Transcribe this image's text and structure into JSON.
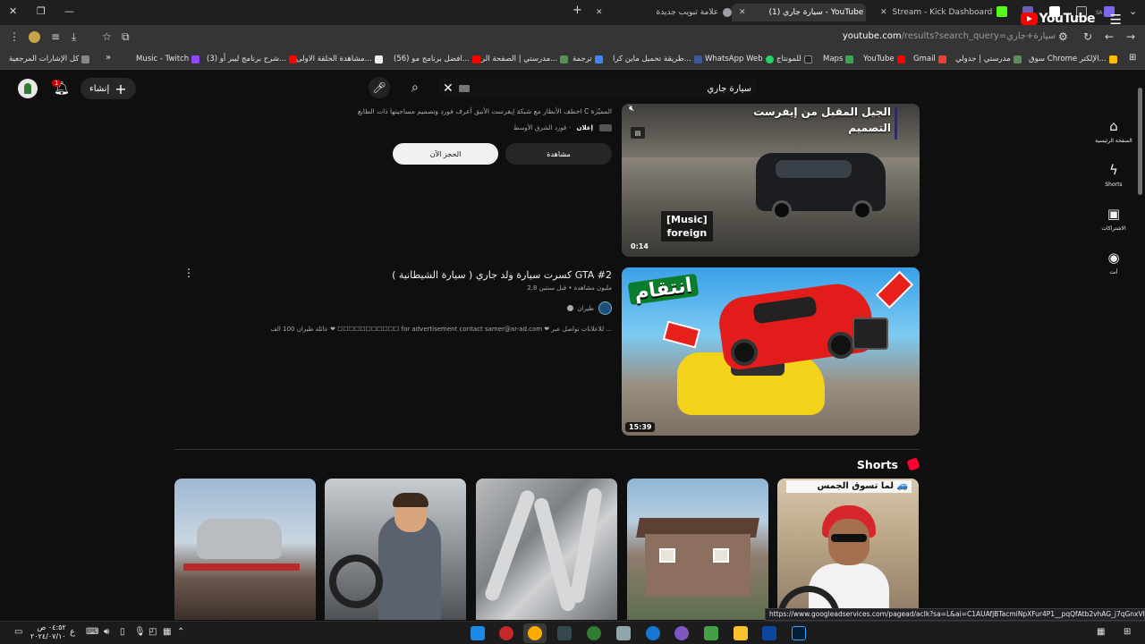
{
  "browser": {
    "tabs": [
      {
        "title": "Stream - Kick Dashboard",
        "fav_color": "#53fc18"
      },
      {
        "title": "(1) سيارة جاري - YouTube",
        "fav_color": "#ff0000",
        "active": true
      },
      {
        "title": "علامة تبويب جديدة",
        "fav_color": "#9aa0a6"
      }
    ],
    "url_host": "youtube.com",
    "url_path": "/results?search_query=سيارة+جاري",
    "bookmarks": [
      "سوق Chrome الإلكتر...",
      "مدرستي | جدولي",
      "Gmail",
      "YouTube",
      "Maps",
      "للمونتاج",
      "WhatsApp Web",
      "طريقة تحميل ماين كرا...",
      "ترجمة",
      "مدرستي | الصفحة الر...",
      "(56) افضل برنامج مو...",
      "مشاهدة الحلقة الاولى...",
      "(3) شرح برنامج ليبر أو...",
      "Music - Twitch",
      "كل الإشارات المرجعية"
    ]
  },
  "youtube": {
    "logo_text": "YouTube",
    "region": "SA",
    "search_value": "سيارة جاري",
    "create_label": "إنشاء",
    "notification_count": "1",
    "guide": [
      {
        "label": "الصفحة الرئيسية",
        "icon": "home-icon"
      },
      {
        "label": "Shorts",
        "icon": "shorts-icon"
      },
      {
        "label": "الاشتراكات",
        "icon": "subscriptions-icon"
      },
      {
        "label": "أنت",
        "icon": "you-icon"
      }
    ]
  },
  "ad": {
    "description": "اخطف الأنظار مع شبكة إيفرست الأنيق أعرف فورد وتصميم مساحيتها ذات الطابع C المميّزة",
    "badge": "إعلان",
    "advertiser": "فورد الشرق الأوسط",
    "watch_label": "مشاهدة",
    "book_label": "الحجز الآن",
    "thumb_headline_1": "الجيل المقبل من إيفرست",
    "thumb_headline_2": "التصميم",
    "thumb_caption": "[Music]\nforeign",
    "duration": "0:14"
  },
  "video2": {
    "title": "كسرت سيارة ولد جاري ( سيارة الشيطانية ) GTA #2",
    "meta": "2.8 مليون مشاهدة • قبل سنتين",
    "channel": "طيران",
    "description": "عائلة طيران 100 الف ❤ ☐☐☐☐☐☐☐☐☐☐☐ for advertisement contact samer@ar-ad.com ❤ للاعلانات تواصل عبر ...",
    "thumb_text": "انتقام",
    "duration": "15:39"
  },
  "shorts": {
    "title": "Shorts",
    "items": [
      {
        "overlay": ""
      },
      {
        "overlay": ""
      },
      {
        "overlay": ""
      },
      {
        "overlay": ""
      },
      {
        "overlay": "لما تسوق الجمس 🚙"
      }
    ]
  },
  "status_bar_url": "https://www.googleadservices.com/pagead/aclk?sa=L&ai=C1AUAfjBTacmiNpXFur4P1__pqQfAtb2vhAG_j7qGnxVkEAE...",
  "taskbar": {
    "time": "٠٤:٥٢ ص",
    "date": "٢٠٢٤/٠٧/١٠",
    "lang": "ع"
  }
}
